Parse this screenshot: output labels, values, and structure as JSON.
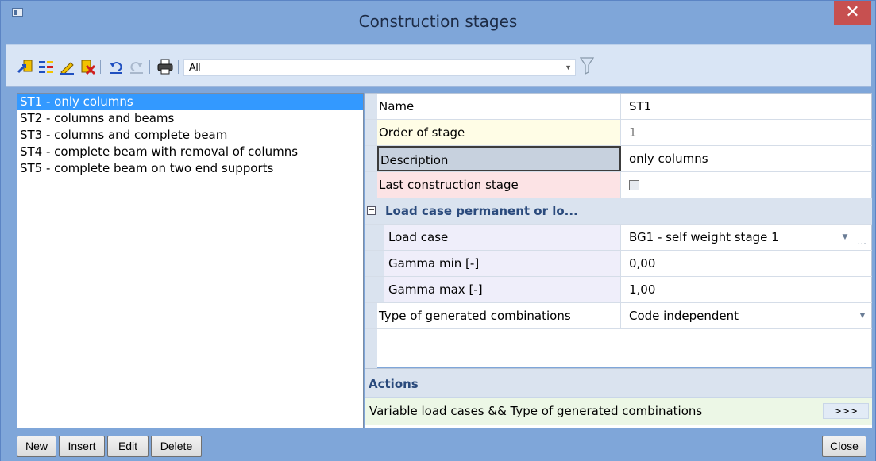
{
  "window": {
    "title": "Construction stages",
    "close_glyph": "✕"
  },
  "toolbar": {
    "icons": [
      "new-stage-icon",
      "insert-stage-icon",
      "edit-icon",
      "delete-icon",
      "undo-icon",
      "redo-icon",
      "print-icon"
    ],
    "filter_value": "All"
  },
  "stages": [
    "ST1 - only columns",
    "ST2 - columns and beams",
    "ST3 - columns and complete beam",
    "ST4 - complete beam with removal of columns",
    "ST5 - complete beam on two end supports"
  ],
  "properties": {
    "name": {
      "label": "Name",
      "value": "ST1"
    },
    "order": {
      "label": "Order of stage",
      "value": "1"
    },
    "description": {
      "label": "Description",
      "value": "only columns"
    },
    "last_stage": {
      "label": "Last construction stage",
      "checked": false
    },
    "group_label": "Load case permanent or lo...",
    "load_case": {
      "label": "Load case",
      "value": "BG1 - self weight stage 1",
      "browse": "..."
    },
    "gamma_min": {
      "label": "Gamma min [-]",
      "value": "0,00"
    },
    "gamma_max": {
      "label": "Gamma max [-]",
      "value": "1,00"
    },
    "combinations": {
      "label": "Type of generated combinations",
      "value": "Code independent"
    }
  },
  "actions": {
    "header": "Actions",
    "row_label": "Variable load cases && Type of generated combinations",
    "row_button": ">>>"
  },
  "buttons": {
    "new": "New",
    "insert": "Insert",
    "edit": "Edit",
    "delete": "Delete",
    "close": "Close"
  },
  "colors": {
    "frame": "#7fa6d9",
    "selection": "#3399ff",
    "close_button": "#c75050",
    "group_text": "#2a4a7c"
  }
}
